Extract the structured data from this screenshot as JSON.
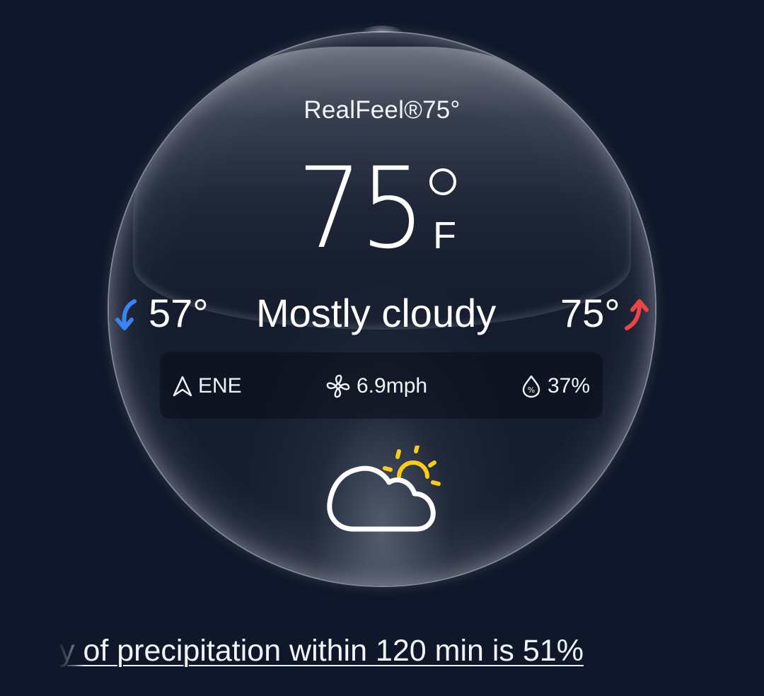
{
  "weather": {
    "realfeel": "RealFeel®75°",
    "temperature": "75",
    "unit": "F",
    "low": "57°",
    "high": "75°",
    "condition": "Mostly cloudy",
    "wind_direction": "ENE",
    "wind_speed": "6.9mph",
    "humidity": "37%",
    "condition_icon": "partly-cloudy-icon"
  },
  "precipitation_text": "y of precipitation within 120 min is 51%",
  "colors": {
    "background": "#0f172a",
    "low_arrow": "#3b82f6",
    "high_arrow": "#ef4444",
    "sun": "#facc15",
    "text": "#ffffff"
  }
}
